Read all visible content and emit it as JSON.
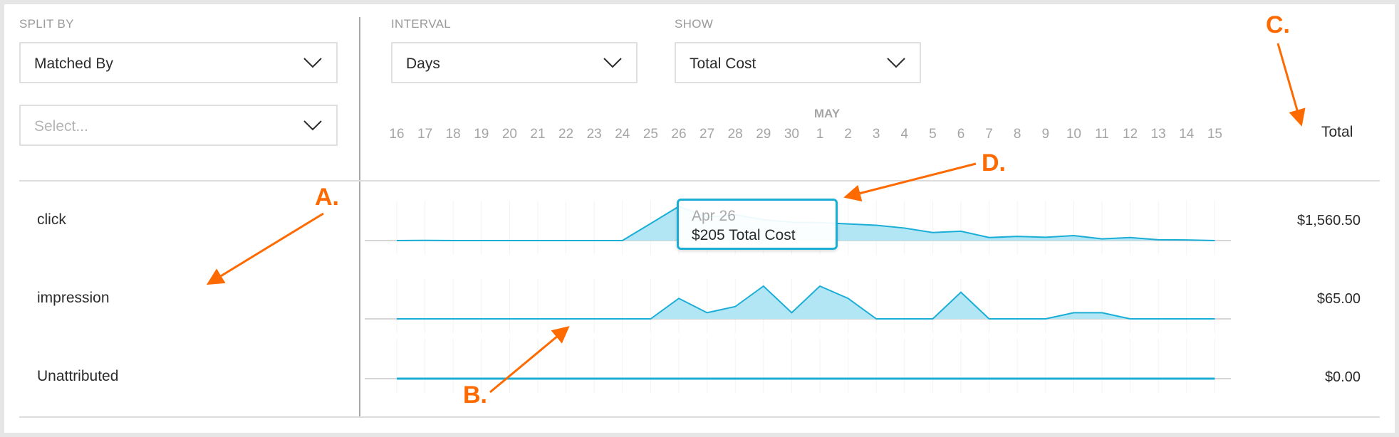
{
  "controls": {
    "split_by": {
      "label": "SPLIT BY",
      "value": "Matched By",
      "secondary_placeholder": "Select..."
    },
    "interval": {
      "label": "INTERVAL",
      "value": "Days"
    },
    "show": {
      "label": "SHOW",
      "value": "Total Cost"
    }
  },
  "header": {
    "total_label": "Total"
  },
  "tooltip": {
    "date": "Apr 26",
    "value": "$205 Total Cost"
  },
  "annotations": [
    "A.",
    "B.",
    "C.",
    "D."
  ],
  "colors": {
    "accent": "#1aaed6",
    "fill": "#b3e6f5",
    "annotation": "#ff6a00"
  },
  "chart_data": {
    "type": "area",
    "month_label": "MAY",
    "x": [
      "16",
      "17",
      "18",
      "19",
      "20",
      "21",
      "22",
      "23",
      "24",
      "25",
      "26",
      "27",
      "28",
      "29",
      "30",
      "1",
      "2",
      "3",
      "4",
      "5",
      "6",
      "7",
      "8",
      "9",
      "10",
      "11",
      "12",
      "13",
      "14",
      "15"
    ],
    "series": [
      {
        "name": "click",
        "total": "$1,560.50",
        "values": [
          0,
          1,
          0,
          0,
          0,
          0,
          0,
          0,
          0,
          102,
          205,
          140,
          155,
          125,
          110,
          108,
          100,
          92,
          75,
          48,
          56,
          18,
          25,
          20,
          30,
          10,
          18,
          5,
          4,
          0
        ]
      },
      {
        "name": "impression",
        "total": "$65.00",
        "values": [
          0,
          0,
          0,
          0,
          0,
          0,
          0,
          0,
          0,
          0,
          10,
          3,
          6,
          16,
          3,
          16,
          10,
          0,
          0,
          0,
          13,
          0,
          0,
          0,
          3,
          3,
          0,
          0,
          0,
          0
        ]
      },
      {
        "name": "Unattributed",
        "total": "$0.00",
        "values": [
          0,
          0,
          0,
          0,
          0,
          0,
          0,
          0,
          0,
          0,
          0,
          0,
          0,
          0,
          0,
          0,
          0,
          0,
          0,
          0,
          0,
          0,
          0,
          0,
          0,
          0,
          0,
          0,
          0,
          0
        ]
      }
    ],
    "y_max": 205
  }
}
